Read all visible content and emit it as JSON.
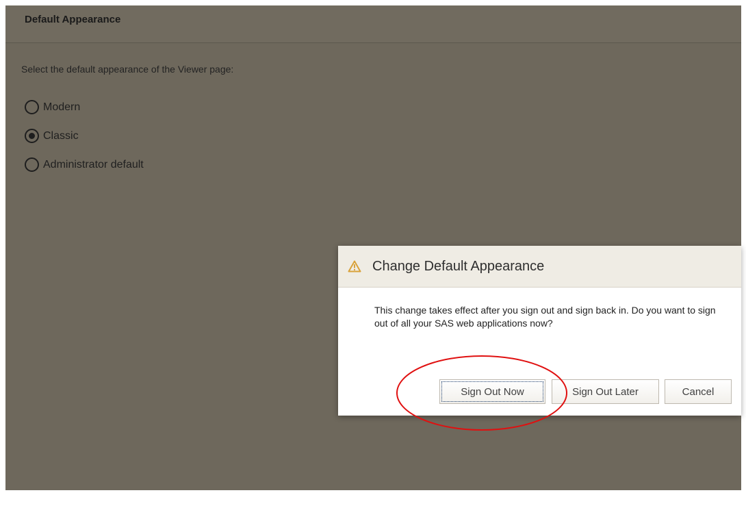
{
  "panel": {
    "title": "Default Appearance",
    "instruction": "Select the default appearance of the Viewer page:",
    "options": [
      {
        "label": "Modern",
        "selected": false
      },
      {
        "label": "Classic",
        "selected": true
      },
      {
        "label": "Administrator default",
        "selected": false
      }
    ]
  },
  "dialog": {
    "title": "Change Default Appearance",
    "icon": "warning-icon",
    "message": "This change takes effect after you sign out and sign back in. Do you want to sign out of all your SAS web applications now?",
    "buttons": {
      "sign_out_now": "Sign Out Now",
      "sign_out_later": "Sign Out Later",
      "cancel": "Cancel"
    }
  },
  "colors": {
    "overlay": "#6e685c",
    "dialog_header": "#efece4",
    "warning": "#d9a23a",
    "annotation": "#e01010"
  }
}
